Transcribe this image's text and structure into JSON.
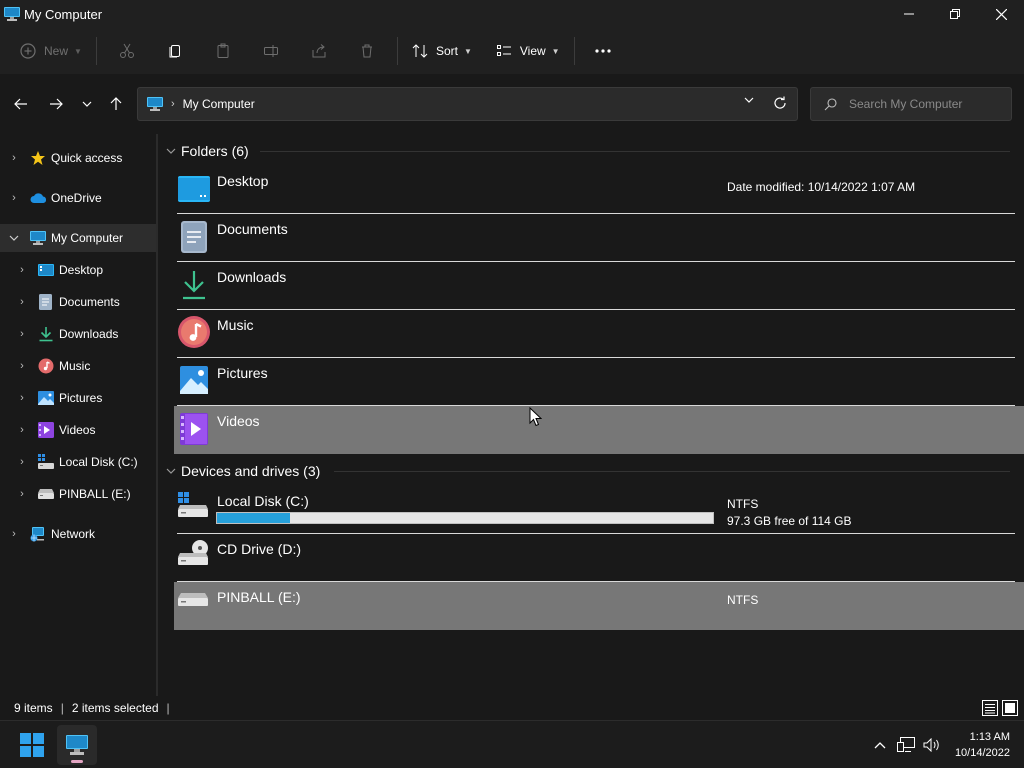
{
  "window": {
    "title": "My Computer",
    "accent": "#26a0da"
  },
  "toolbar": {
    "new_label": "New",
    "sort_label": "Sort",
    "view_label": "View"
  },
  "address": {
    "path": "My Computer",
    "search_placeholder": "Search My Computer"
  },
  "sidebar": {
    "items": [
      {
        "label": "Quick access",
        "icon": "star-icon"
      },
      {
        "label": "OneDrive",
        "icon": "cloud-icon"
      },
      {
        "label": "My Computer",
        "icon": "computer-icon",
        "selected": true
      },
      {
        "label": "Desktop",
        "icon": "desktop-icon"
      },
      {
        "label": "Documents",
        "icon": "documents-icon"
      },
      {
        "label": "Downloads",
        "icon": "downloads-icon"
      },
      {
        "label": "Music",
        "icon": "music-icon"
      },
      {
        "label": "Pictures",
        "icon": "pictures-icon"
      },
      {
        "label": "Videos",
        "icon": "videos-icon"
      },
      {
        "label": "Local Disk (C:)",
        "icon": "drive-icon"
      },
      {
        "label": "PINBALL (E:)",
        "icon": "drive-icon"
      },
      {
        "label": "Network",
        "icon": "network-icon"
      }
    ]
  },
  "folders": {
    "header": "Folders (6)",
    "items": [
      {
        "name": "Desktop",
        "meta": "Date modified: 10/14/2022 1:07 AM"
      },
      {
        "name": "Documents"
      },
      {
        "name": "Downloads"
      },
      {
        "name": "Music"
      },
      {
        "name": "Pictures"
      },
      {
        "name": "Videos",
        "selected": true
      }
    ]
  },
  "drives": {
    "header": "Devices and drives (3)",
    "items": [
      {
        "name": "Local Disk (C:)",
        "fs": "NTFS",
        "free": "97.3 GB free of 114 GB",
        "used_fraction": 0.147
      },
      {
        "name": "CD Drive (D:)"
      },
      {
        "name": "PINBALL (E:)",
        "fs": "NTFS",
        "selected": true
      }
    ]
  },
  "status": {
    "count": "9 items",
    "selected": "2 items selected"
  },
  "taskbar": {
    "time": "1:13 AM",
    "date": "10/14/2022"
  }
}
